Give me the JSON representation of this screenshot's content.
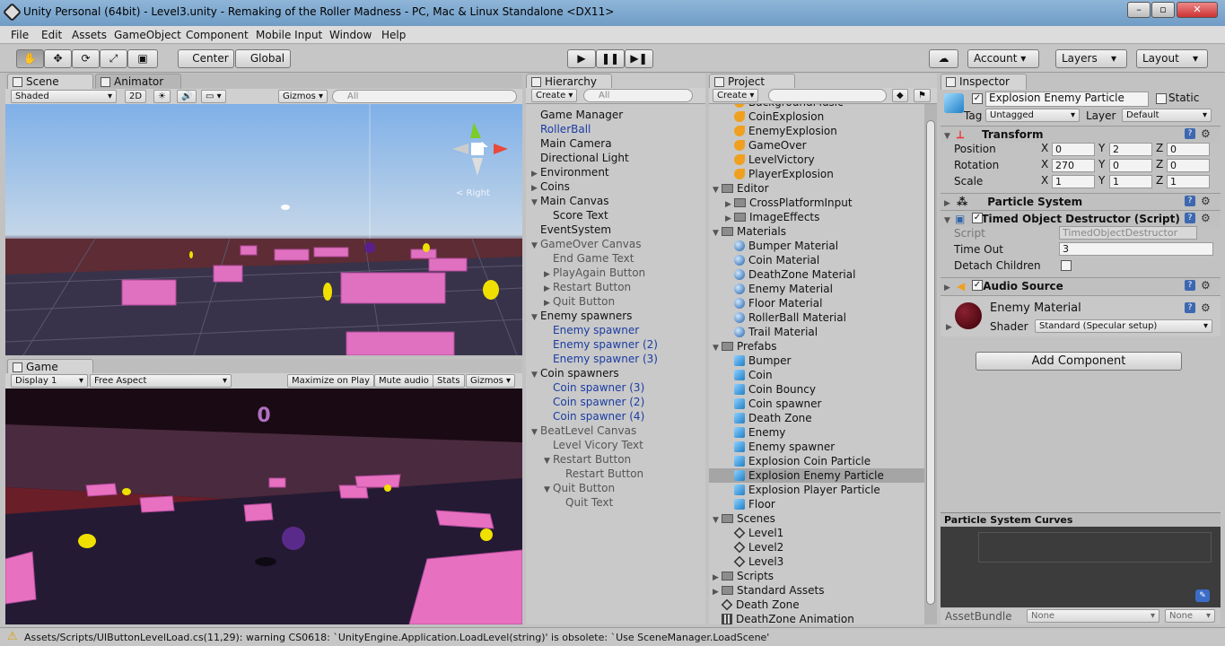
{
  "window": {
    "title": "Unity Personal (64bit) - Level3.unity - Remaking of the Roller Madness - PC, Mac & Linux Standalone <DX11>"
  },
  "menu": [
    "File",
    "Edit",
    "Assets",
    "GameObject",
    "Component",
    "Mobile Input",
    "Window",
    "Help"
  ],
  "toolbar": {
    "pivot": "Center",
    "space": "Global",
    "account": "Account",
    "layers": "Layers",
    "layout": "Layout"
  },
  "scene": {
    "tab": "Scene",
    "tab2": "Animator",
    "shading": "Shaded",
    "mode2d": "2D",
    "gizmos": "Gizmos",
    "search_placeholder": "All",
    "gizmo_label": "< Right"
  },
  "game": {
    "tab": "Game",
    "display": "Display 1",
    "aspect": "Free Aspect",
    "maximize": "Maximize on Play",
    "mute": "Mute audio",
    "stats": "Stats",
    "gizmos": "Gizmos",
    "score": "0"
  },
  "hierarchy": {
    "tab": "Hierarchy",
    "create": "Create",
    "search_placeholder": "All",
    "items": [
      {
        "label": "Game Manager",
        "depth": 0,
        "tri": "",
        "style": ""
      },
      {
        "label": "RollerBall",
        "depth": 0,
        "tri": "",
        "style": "blue"
      },
      {
        "label": "Main Camera",
        "depth": 0,
        "tri": "",
        "style": ""
      },
      {
        "label": "Directional Light",
        "depth": 0,
        "tri": "",
        "style": ""
      },
      {
        "label": "Environment",
        "depth": 0,
        "tri": "▶",
        "style": ""
      },
      {
        "label": "Coins",
        "depth": 0,
        "tri": "▶",
        "style": ""
      },
      {
        "label": "Main Canvas",
        "depth": 0,
        "tri": "▼",
        "style": ""
      },
      {
        "label": "Score Text",
        "depth": 1,
        "tri": "",
        "style": ""
      },
      {
        "label": "EventSystem",
        "depth": 0,
        "tri": "",
        "style": ""
      },
      {
        "label": "GameOver Canvas",
        "depth": 0,
        "tri": "▼",
        "style": "grey"
      },
      {
        "label": "End Game Text",
        "depth": 1,
        "tri": "",
        "style": "grey"
      },
      {
        "label": "PlayAgain Button",
        "depth": 1,
        "tri": "▶",
        "style": "grey"
      },
      {
        "label": "Restart Button",
        "depth": 1,
        "tri": "▶",
        "style": "grey"
      },
      {
        "label": "Quit Button",
        "depth": 1,
        "tri": "▶",
        "style": "grey"
      },
      {
        "label": "Enemy spawners",
        "depth": 0,
        "tri": "▼",
        "style": ""
      },
      {
        "label": "Enemy spawner",
        "depth": 1,
        "tri": "",
        "style": "blue"
      },
      {
        "label": "Enemy spawner (2)",
        "depth": 1,
        "tri": "",
        "style": "blue"
      },
      {
        "label": "Enemy spawner (3)",
        "depth": 1,
        "tri": "",
        "style": "blue"
      },
      {
        "label": "Coin spawners",
        "depth": 0,
        "tri": "▼",
        "style": ""
      },
      {
        "label": "Coin spawner (3)",
        "depth": 1,
        "tri": "",
        "style": "blue"
      },
      {
        "label": "Coin spawner (2)",
        "depth": 1,
        "tri": "",
        "style": "blue"
      },
      {
        "label": "Coin spawner (4)",
        "depth": 1,
        "tri": "",
        "style": "blue"
      },
      {
        "label": "BeatLevel Canvas",
        "depth": 0,
        "tri": "▼",
        "style": "grey"
      },
      {
        "label": "Level Vicory Text",
        "depth": 1,
        "tri": "",
        "style": "grey"
      },
      {
        "label": "Restart Button",
        "depth": 1,
        "tri": "▼",
        "style": "grey"
      },
      {
        "label": "Restart Button",
        "depth": 2,
        "tri": "",
        "style": "grey"
      },
      {
        "label": "Quit Button",
        "depth": 1,
        "tri": "▼",
        "style": "grey"
      },
      {
        "label": "Quit Text",
        "depth": 2,
        "tri": "",
        "style": "grey"
      }
    ]
  },
  "project": {
    "tab": "Project",
    "create": "Create",
    "items": [
      {
        "label": "BackgroundMusic",
        "depth": 1,
        "tri": "",
        "icon": "audio"
      },
      {
        "label": "CoinExplosion",
        "depth": 1,
        "tri": "",
        "icon": "audio"
      },
      {
        "label": "EnemyExplosion",
        "depth": 1,
        "tri": "",
        "icon": "audio"
      },
      {
        "label": "GameOver",
        "depth": 1,
        "tri": "",
        "icon": "audio"
      },
      {
        "label": "LevelVictory",
        "depth": 1,
        "tri": "",
        "icon": "audio"
      },
      {
        "label": "PlayerExplosion",
        "depth": 1,
        "tri": "",
        "icon": "audio"
      },
      {
        "label": "Editor",
        "depth": 0,
        "tri": "▼",
        "icon": "folder"
      },
      {
        "label": "CrossPlatformInput",
        "depth": 1,
        "tri": "▶",
        "icon": "folder"
      },
      {
        "label": "ImageEffects",
        "depth": 1,
        "tri": "▶",
        "icon": "folder"
      },
      {
        "label": "Materials",
        "depth": 0,
        "tri": "▼",
        "icon": "folder"
      },
      {
        "label": "Bumper Material",
        "depth": 1,
        "tri": "",
        "icon": "sphere"
      },
      {
        "label": "Coin Material",
        "depth": 1,
        "tri": "",
        "icon": "sphere"
      },
      {
        "label": "DeathZone Material",
        "depth": 1,
        "tri": "",
        "icon": "sphere"
      },
      {
        "label": "Enemy Material",
        "depth": 1,
        "tri": "",
        "icon": "sphere"
      },
      {
        "label": "Floor Material",
        "depth": 1,
        "tri": "",
        "icon": "sphere"
      },
      {
        "label": "RollerBall Material",
        "depth": 1,
        "tri": "",
        "icon": "sphere"
      },
      {
        "label": "Trail Material",
        "depth": 1,
        "tri": "",
        "icon": "sphere"
      },
      {
        "label": "Prefabs",
        "depth": 0,
        "tri": "▼",
        "icon": "folder"
      },
      {
        "label": "Bumper",
        "depth": 1,
        "tri": "",
        "icon": "cube"
      },
      {
        "label": "Coin",
        "depth": 1,
        "tri": "",
        "icon": "cube"
      },
      {
        "label": "Coin Bouncy",
        "depth": 1,
        "tri": "",
        "icon": "cube"
      },
      {
        "label": "Coin spawner",
        "depth": 1,
        "tri": "",
        "icon": "cube"
      },
      {
        "label": "Death Zone",
        "depth": 1,
        "tri": "",
        "icon": "cube"
      },
      {
        "label": "Enemy",
        "depth": 1,
        "tri": "",
        "icon": "cube"
      },
      {
        "label": "Enemy spawner",
        "depth": 1,
        "tri": "",
        "icon": "cube"
      },
      {
        "label": "Explosion Coin Particle",
        "depth": 1,
        "tri": "",
        "icon": "cube"
      },
      {
        "label": "Explosion Enemy Particle",
        "depth": 1,
        "tri": "",
        "icon": "cube",
        "selected": true
      },
      {
        "label": "Explosion Player Particle",
        "depth": 1,
        "tri": "",
        "icon": "cube"
      },
      {
        "label": "Floor",
        "depth": 1,
        "tri": "",
        "icon": "cube"
      },
      {
        "label": "Scenes",
        "depth": 0,
        "tri": "▼",
        "icon": "folder"
      },
      {
        "label": "Level1",
        "depth": 1,
        "tri": "",
        "icon": "scene"
      },
      {
        "label": "Level2",
        "depth": 1,
        "tri": "",
        "icon": "scene"
      },
      {
        "label": "Level3",
        "depth": 1,
        "tri": "",
        "icon": "scene"
      },
      {
        "label": "Scripts",
        "depth": 0,
        "tri": "▶",
        "icon": "folder"
      },
      {
        "label": "Standard Assets",
        "depth": 0,
        "tri": "▶",
        "icon": "folder"
      },
      {
        "label": "Death Zone",
        "depth": 0,
        "tri": "",
        "icon": "scene"
      },
      {
        "label": "DeathZone Animation",
        "depth": 0,
        "tri": "",
        "icon": "anim"
      }
    ]
  },
  "inspector": {
    "tab": "Inspector",
    "object_name": "Explosion Enemy Particle",
    "static_label": "Static",
    "tag_label": "Tag",
    "tag_value": "Untagged",
    "layer_label": "Layer",
    "layer_value": "Default",
    "transform": {
      "title": "Transform",
      "position_label": "Position",
      "rotation_label": "Rotation",
      "scale_label": "Scale",
      "position": [
        "0",
        "2",
        "0"
      ],
      "rotation": [
        "270",
        "0",
        "0"
      ],
      "scale": [
        "1",
        "1",
        "1"
      ]
    },
    "particle_system": "Particle System",
    "destructor": {
      "title": "Timed Object Destructor (Script)",
      "script_label": "Script",
      "script_value": "TimedObjectDestructor",
      "timeout_label": "Time Out",
      "timeout_value": "3",
      "detach_label": "Detach Children"
    },
    "audio_source": "Audio Source",
    "material": {
      "name": "Enemy Material",
      "shader_label": "Shader",
      "shader_value": "Standard (Specular setup)"
    },
    "add_component": "Add Component",
    "curves_title": "Particle System Curves",
    "assetbundle_label": "AssetBundle",
    "assetbundle_value": "None",
    "assetbundle_variant": "None"
  },
  "console": {
    "message": "Assets/Scripts/UIButtonLevelLoad.cs(11,29): warning CS0618: `UnityEngine.Application.LoadLevel(string)' is obsolete: `Use SceneManager.LoadScene'"
  }
}
